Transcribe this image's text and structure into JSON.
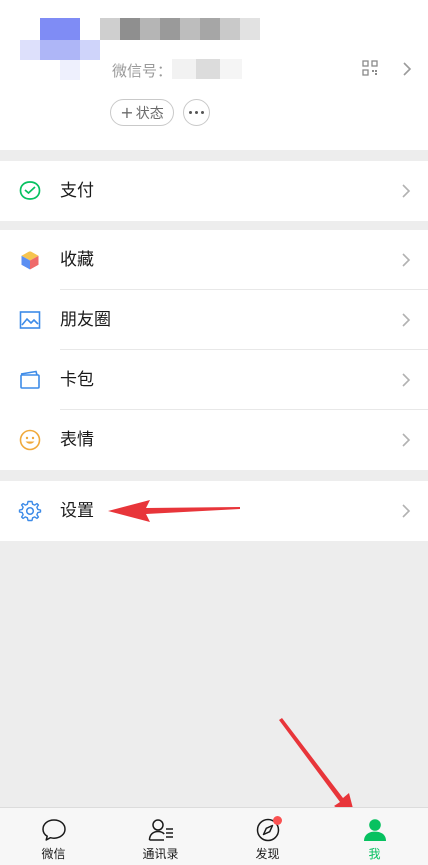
{
  "profile": {
    "wechat_id_label": "微信号：",
    "status_button_label": "状态",
    "status_button_plus": "+"
  },
  "menu": {
    "pay_label": "支付",
    "favorites_label": "收藏",
    "moments_label": "朋友圈",
    "cards_label": "卡包",
    "stickers_label": "表情",
    "settings_label": "设置"
  },
  "tabbar": {
    "chats_label": "微信",
    "contacts_label": "通讯录",
    "discover_label": "发现",
    "me_label": "我"
  },
  "colors": {
    "accent": "#07c160",
    "arrow": "#e8353a",
    "badge": "#fa5151",
    "background": "#ededed"
  },
  "icons": {
    "pay": "wallet-check-icon",
    "favorites": "cube-icon",
    "moments": "picture-icon",
    "cards": "card-icon",
    "stickers": "smiley-icon",
    "settings": "gear-icon",
    "qr": "qr-code-icon"
  }
}
